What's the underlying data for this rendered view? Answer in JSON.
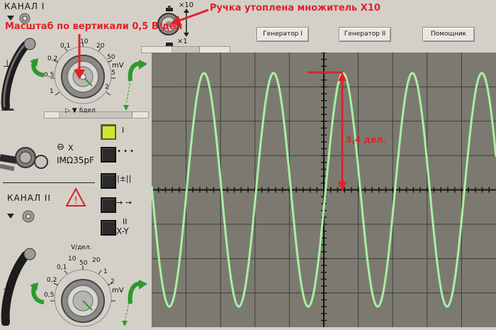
{
  "channel1": {
    "title": "КАНАЛ I",
    "knob_units": "mV",
    "knob_scale": [
      "0,1",
      "0,2",
      "0,5",
      "1",
      "2",
      "5",
      "10",
      "20",
      "50"
    ],
    "div_label": "▷ ▼ 6дел"
  },
  "channel2": {
    "title": "КАНАЛ II",
    "knob_top_label": "V/дел.",
    "knob_units": "mV",
    "knob_scale": [
      "0,1",
      "0,2",
      "0,5",
      "10",
      "20",
      "50",
      "1",
      "2",
      "5"
    ]
  },
  "input": {
    "label_x": "X",
    "label_spec": "IMΩ35pF"
  },
  "multiplier": {
    "top": "×10",
    "bottom": "×1"
  },
  "mode_buttons": [
    {
      "symbol": "I"
    },
    {
      "symbol": "• • •"
    },
    {
      "symbol": "|±||"
    },
    {
      "symbol": "→ →"
    },
    {
      "symbol": "II"
    },
    {
      "symbol": "X-Y"
    }
  ],
  "toolbar": {
    "gen1_label": "Генератор I",
    "gen2_label": "Генератор II",
    "helper_label": "Помощник"
  },
  "annotations": {
    "scale_note": "Масштаб по вертикали 0,5 В/дел",
    "knob_note": "Ручка утоплена множитель Х10",
    "amplitude_note": "3,4 дел."
  },
  "colors": {
    "trace": "#a7f0a2",
    "annotation": "#e0222a",
    "screen": "#7c7a70",
    "lamp": "#cde832",
    "arrow_green": "#2d9a2d"
  }
}
